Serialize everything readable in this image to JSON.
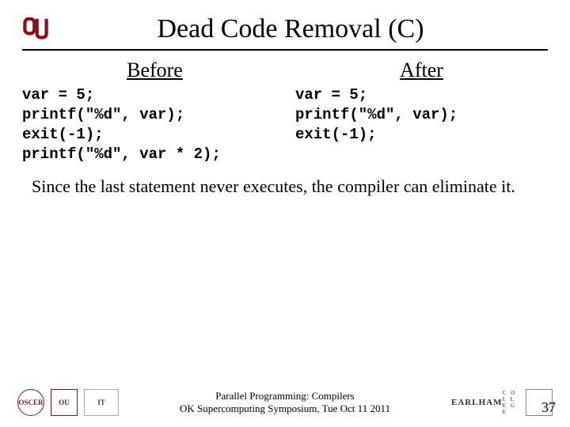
{
  "header": {
    "title": "Dead Code Removal (C)"
  },
  "before": {
    "heading": "Before",
    "code": "var = 5;\nprintf(\"%d\", var);\nexit(-1);\nprintf(\"%d\", var * 2);"
  },
  "after": {
    "heading": "After",
    "code": "var = 5;\nprintf(\"%d\", var);\nexit(-1);"
  },
  "explain": "Since the last statement never executes, the compiler can eliminate it.",
  "footer": {
    "line1": "Parallel Programming: Compilers",
    "line2": "OK Supercomputing Symposium, Tue Oct 11 2011"
  },
  "page_number": "37",
  "logos": {
    "ou_small": "OU",
    "seal": "OSCER",
    "it": "IT",
    "earlham": "EARLHAM",
    "earlham_sub": "C O L L E G E",
    "crest": " "
  }
}
